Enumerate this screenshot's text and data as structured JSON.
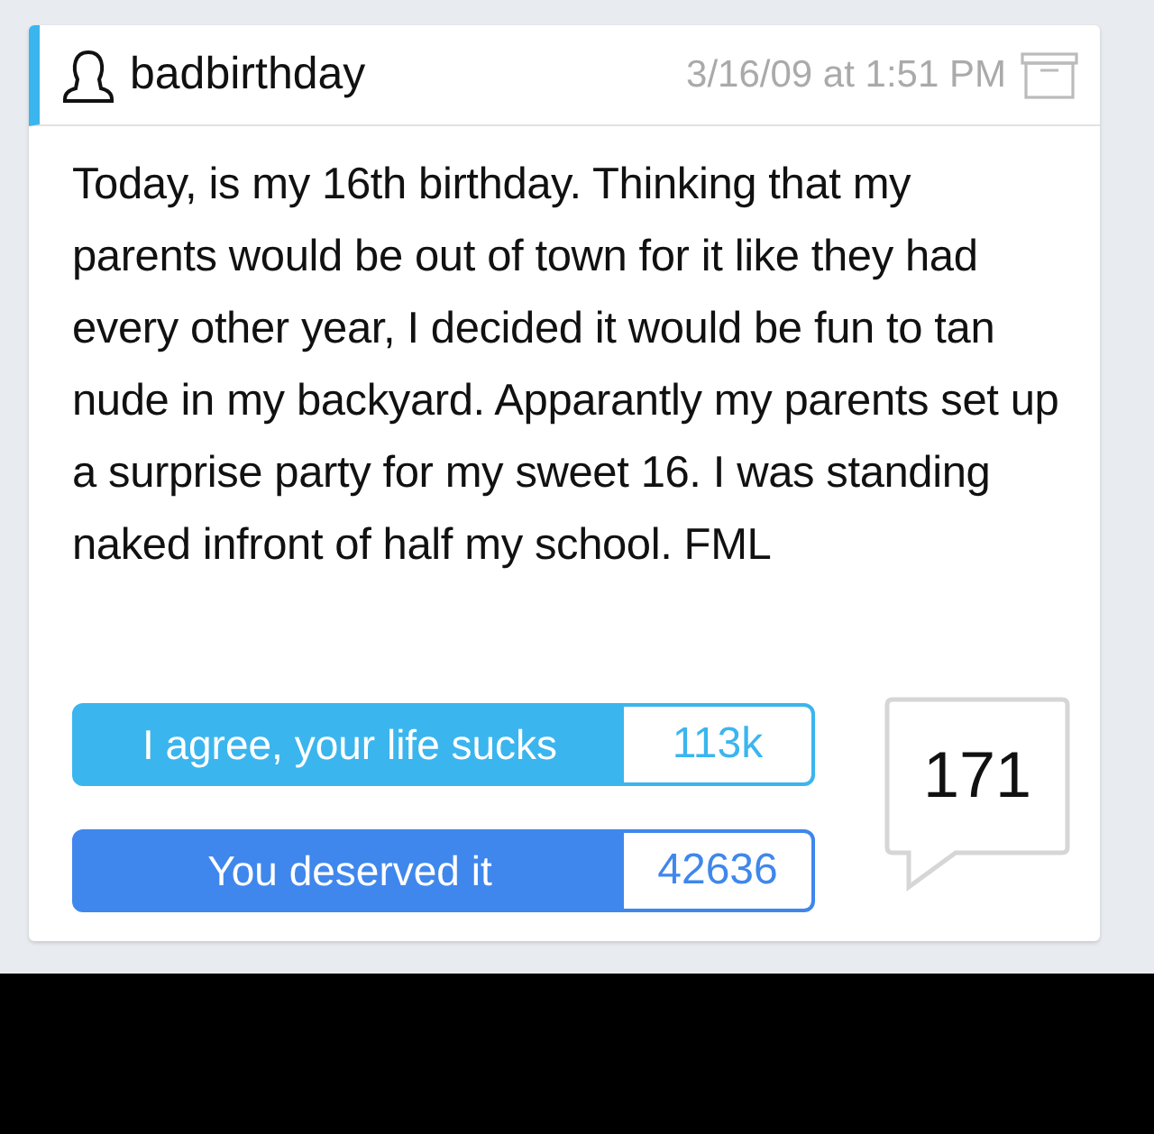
{
  "post": {
    "username": "badbirthday",
    "timestamp": "3/16/09 at 1:51 PM",
    "text": "Today, is my 16th birthday. Thinking that my parents would be out of town for it like they had every other year, I decided it would be fun to tan nude in my backyard. Apparantly my parents set up a surprise party for my sweet 16. I was standing naked infront of half my school. FML"
  },
  "votes": [
    {
      "label": "I agree, your life sucks",
      "count": "113k",
      "color": "#3bb5ee"
    },
    {
      "label": "You deserved it",
      "count": "42636",
      "color": "#3f87ec"
    }
  ],
  "comments": {
    "count": "171"
  }
}
